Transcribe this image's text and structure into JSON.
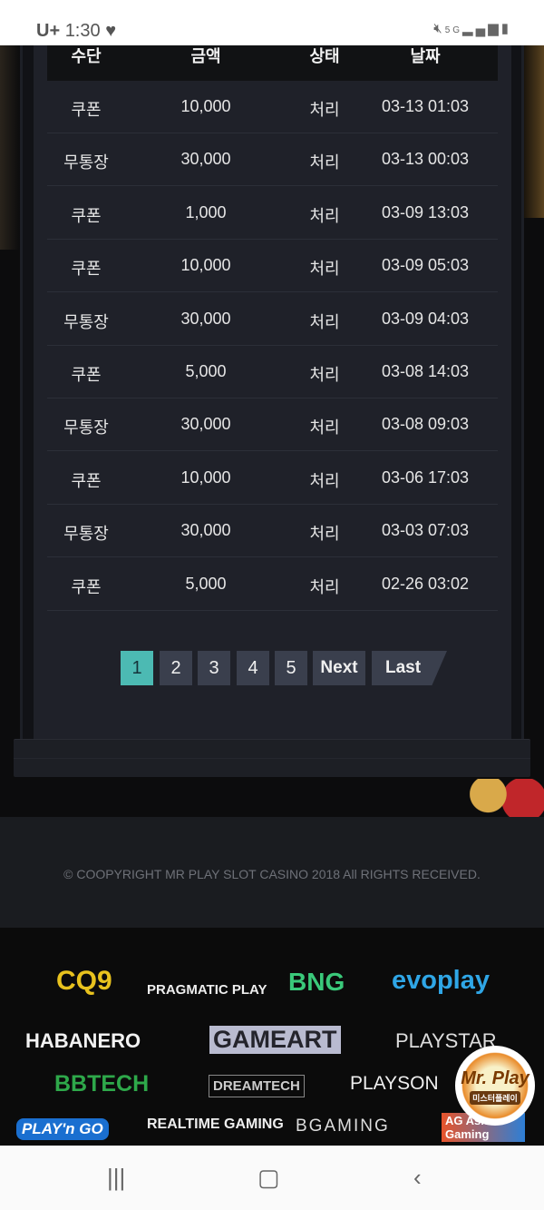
{
  "status_bar": {
    "carrier": "U+",
    "time": "1:30",
    "icons": [
      "heart-icon",
      "mute-icon",
      "5g-icon",
      "signal-icon",
      "battery-icon"
    ]
  },
  "table": {
    "headers": [
      "수단",
      "금액",
      "상태",
      "날짜"
    ],
    "rows": [
      [
        "쿠폰",
        "10,000",
        "처리",
        "03-13 01:03"
      ],
      [
        "무통장",
        "30,000",
        "처리",
        "03-13 00:03"
      ],
      [
        "쿠폰",
        "1,000",
        "처리",
        "03-09 13:03"
      ],
      [
        "쿠폰",
        "10,000",
        "처리",
        "03-09 05:03"
      ],
      [
        "무통장",
        "30,000",
        "처리",
        "03-09 04:03"
      ],
      [
        "쿠폰",
        "5,000",
        "처리",
        "03-08 14:03"
      ],
      [
        "무통장",
        "30,000",
        "처리",
        "03-08 09:03"
      ],
      [
        "쿠폰",
        "10,000",
        "처리",
        "03-06 17:03"
      ],
      [
        "무통장",
        "30,000",
        "처리",
        "03-03 07:03"
      ],
      [
        "쿠폰",
        "5,000",
        "처리",
        "02-26 03:02"
      ]
    ]
  },
  "pagination": {
    "pages": [
      "1",
      "2",
      "3",
      "4",
      "5"
    ],
    "current": "1",
    "next": "Next",
    "last": "Last"
  },
  "footer": {
    "copyright": "© COOPYRIGHT MR PLAY SLOT CASINO 2018 All RIGHTS RECEIVED."
  },
  "providers": [
    "CQ9",
    "PRAGMATIC PLAY",
    "BNG",
    "evoplay",
    "HABANERO",
    "GAMEART",
    "PLAYSTAR",
    "BBTECH",
    "DREAMTECH",
    "PLAYSON",
    "PLAY'n GO",
    "REALTIME GAMING",
    "BGAMING",
    "AG Asia Gaming"
  ],
  "badge": {
    "text": "Mr. Play",
    "subtitle": "미스터플레이"
  },
  "colors": {
    "accent": "#4cbab3",
    "panel": "#1f2129",
    "button": "#3a3f4d"
  }
}
